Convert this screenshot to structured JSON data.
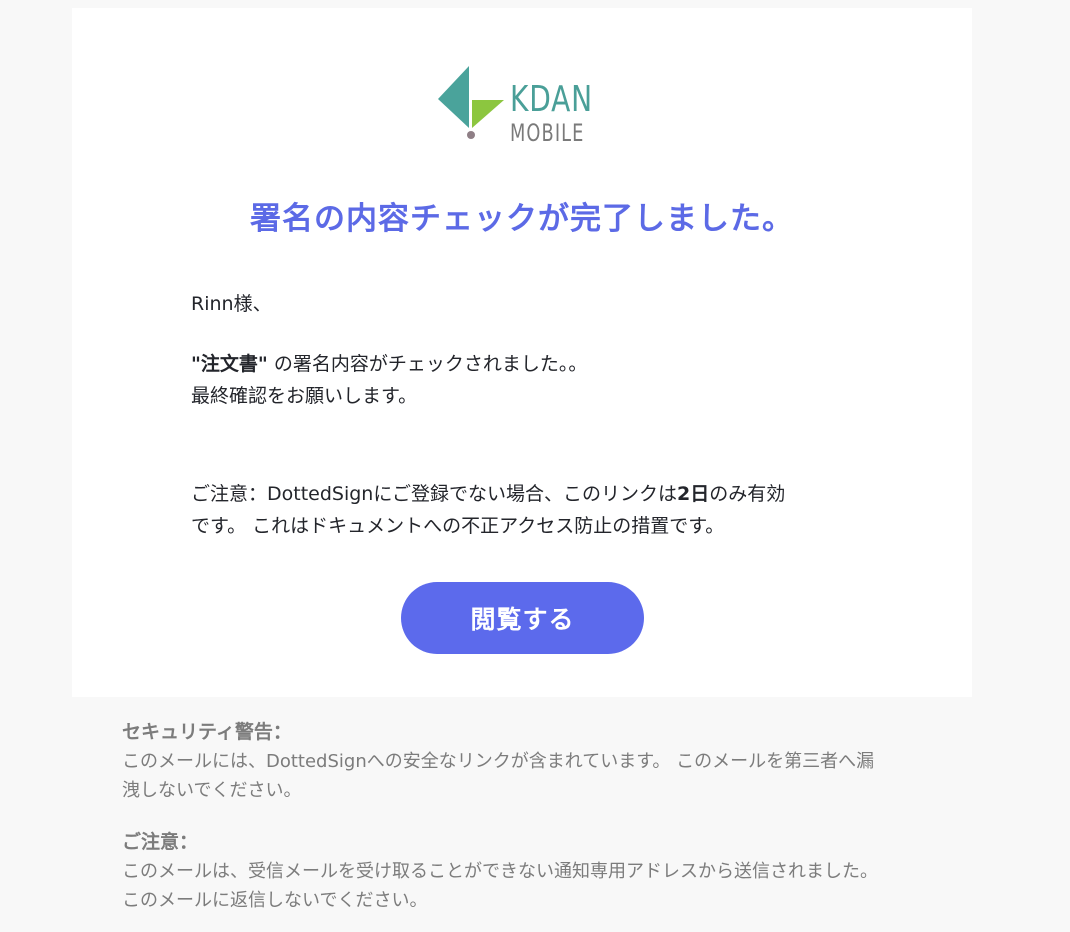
{
  "logo": {
    "text_top": "KDAN",
    "text_bottom": "MOBILE",
    "colors": {
      "teal": "#4a9f98",
      "green": "#8cc63f",
      "gray": "#7a7a7a"
    }
  },
  "email": {
    "title": "署名の内容チェックが完了しました。",
    "greeting": "Rinn様、",
    "message": {
      "doc_name": "\"注文書\"",
      "line1_rest": " の署名内容がチェックされました。。",
      "line2": "最終確認をお願いします。"
    },
    "notice": {
      "prefix": "ご注意：DottedSignにご登録でない場合、このリンクは",
      "days": "2日",
      "suffix_line1": "のみ有効",
      "line2": "です。 これはドキュメントへの不正アクセス防止の措置です。"
    },
    "button_label": "閲覧する"
  },
  "footer": {
    "security_heading": "セキュリティ警告：",
    "security_line1": "このメールには、DottedSignへの安全なリンクが含まれています。 このメールを第三者へ漏",
    "security_line2": "洩しないでください。",
    "notice_heading": "ご注意：",
    "notice_line1": "このメールは、受信メールを受け取ることができない通知専用アドレスから送信されました。",
    "notice_line2": "このメールに返信しないでください。"
  },
  "colors": {
    "accent": "#5c6aec",
    "title": "#5c6ae6",
    "background": "#f8f8f8",
    "card": "#ffffff"
  }
}
